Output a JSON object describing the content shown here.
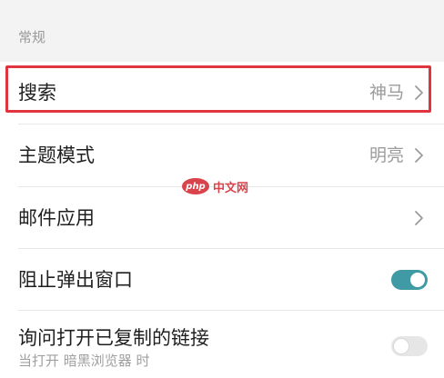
{
  "section": {
    "title": "常规"
  },
  "settings": {
    "search": {
      "label": "搜索",
      "value": "神马",
      "icon": "chevron-right-icon"
    },
    "theme": {
      "label": "主题模式",
      "value": "明亮",
      "icon": "chevron-right-icon"
    },
    "mail": {
      "label": "邮件应用",
      "icon": "chevron-right-icon"
    },
    "popup": {
      "label": "阻止弹出窗口",
      "enabled": true
    },
    "copy_link": {
      "label": "询问打开已复制的链接",
      "sub": "当打开 暗黑浏览器 时",
      "enabled": false
    }
  },
  "watermark": {
    "logo": "php",
    "text": "中文网"
  },
  "colors": {
    "toggle_on": "#3f9aa6",
    "highlight": "#e0353f",
    "secondary_text": "#9b9b9b"
  }
}
